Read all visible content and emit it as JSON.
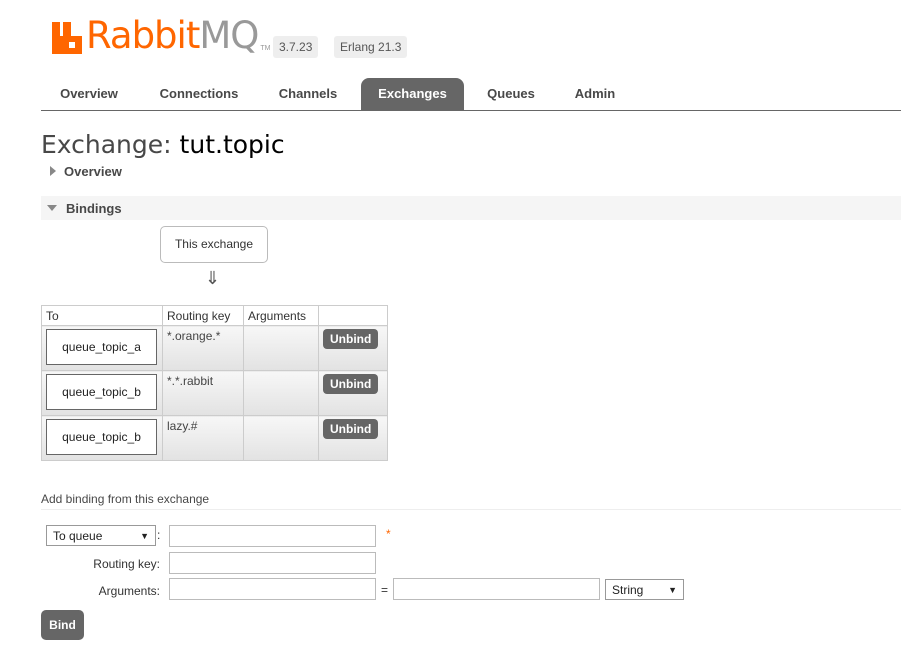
{
  "header": {
    "logo_main": "Rabbit",
    "logo_accent": "MQ",
    "logo_tm": "TM",
    "version": "3.7.23",
    "erlang": "Erlang 21.3"
  },
  "tabs": [
    {
      "label": "Overview"
    },
    {
      "label": "Connections"
    },
    {
      "label": "Channels"
    },
    {
      "label": "Exchanges",
      "active": true
    },
    {
      "label": "Queues"
    },
    {
      "label": "Admin"
    }
  ],
  "page": {
    "title_prefix": "Exchange:",
    "title_name": "tut.topic"
  },
  "sections": {
    "overview": "Overview",
    "bindings": "Bindings"
  },
  "bindings": {
    "source_label": "This exchange",
    "arrow": "⇓",
    "columns": [
      "To",
      "Routing key",
      "Arguments",
      ""
    ],
    "rows": [
      {
        "to": "queue_topic_a",
        "routing_key": "*.orange.*",
        "arguments": "",
        "action": "Unbind"
      },
      {
        "to": "queue_topic_b",
        "routing_key": "*.*.rabbit",
        "arguments": "",
        "action": "Unbind"
      },
      {
        "to": "queue_topic_b",
        "routing_key": "lazy.#",
        "arguments": "",
        "action": "Unbind"
      }
    ]
  },
  "add_binding": {
    "title": "Add binding from this exchange",
    "destination_type": "To queue",
    "destination_value": "",
    "required_mark": "*",
    "routing_key_label": "Routing key:",
    "routing_key_value": "",
    "arguments_label": "Arguments:",
    "arg_key": "",
    "equals": "=",
    "arg_value": "",
    "arg_type": "String",
    "bind_label": "Bind"
  },
  "colors": {
    "brand": "#ff6600",
    "tab_active": "#666666"
  }
}
